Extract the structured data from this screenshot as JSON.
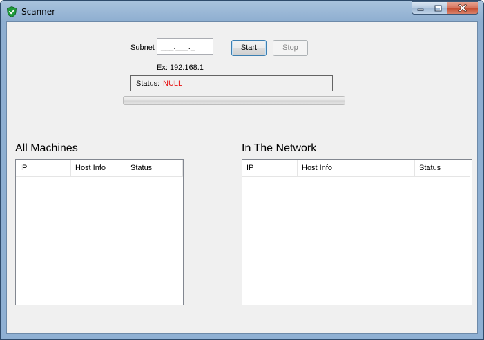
{
  "window": {
    "title": "Scanner",
    "icon": "shield-check-icon",
    "controls": [
      "minimize-icon",
      "maximize-icon",
      "close-icon"
    ]
  },
  "form": {
    "subnet_label": "Subnet",
    "subnet_value": "___.___._",
    "example_text": "Ex: 192.168.1",
    "start_label": "Start",
    "stop_label": "Stop",
    "stop_enabled": false
  },
  "status": {
    "label": "Status:",
    "value": "NULL",
    "value_color": "#e81515"
  },
  "progress": {
    "percent": 0
  },
  "all_machines": {
    "title": "All Machines",
    "columns": [
      "IP",
      "Host Info",
      "Status"
    ],
    "rows": []
  },
  "in_network": {
    "title": "In The Network",
    "columns": [
      "IP",
      "Host Info",
      "Status"
    ],
    "rows": []
  }
}
